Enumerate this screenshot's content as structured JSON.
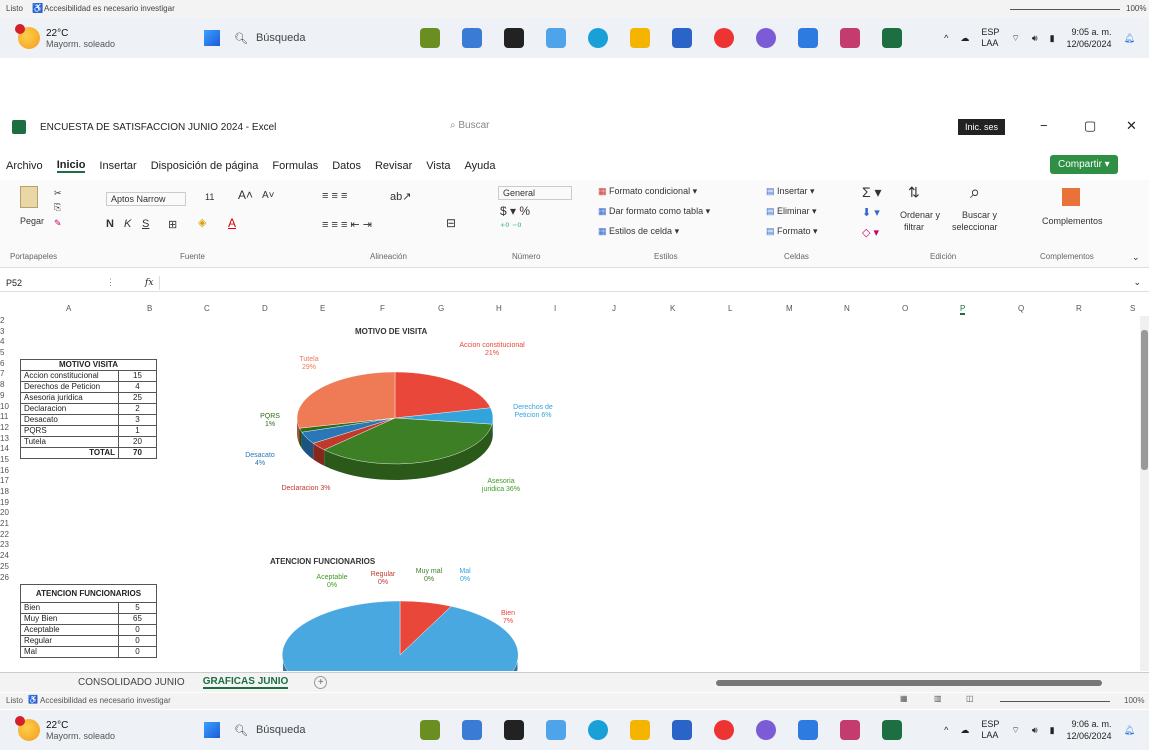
{
  "top_status": {
    "ready": "Listo",
    "accessibility": "Accesibilidad es necesario investigar",
    "zoom": "100%"
  },
  "taskbar_top": {
    "temp": "22°C",
    "weather": "Mayorm. soleado",
    "search": "Búsqueda",
    "lang1": "ESP",
    "lang2": "LAA",
    "time": "9:05 a. m.",
    "date": "12/06/2024"
  },
  "window": {
    "title": "ENCUESTA DE SATISFACCION JUNIO 2024 - Excel",
    "search_placeholder": "Buscar",
    "signin": "Inic. ses",
    "minimize": "−",
    "restore": "▢",
    "close": "✕"
  },
  "menu": {
    "items": [
      "Archivo",
      "Inicio",
      "Insertar",
      "Disposición de página",
      "Formulas",
      "Datos",
      "Revisar",
      "Vista",
      "Ayuda"
    ],
    "share": "Compartir"
  },
  "ribbon": {
    "paste": "Pegar",
    "font_name": "Aptos Narrow",
    "font_size": "11",
    "number_format": "General",
    "cond_format": "Formato condicional",
    "format_table": "Dar formato como tabla",
    "cell_styles": "Estilos de celda",
    "insert": "Insertar",
    "delete": "Eliminar",
    "format": "Formato",
    "sort_filter_1": "Ordenar y",
    "sort_filter_2": "filtrar",
    "find_1": "Buscar y",
    "find_2": "seleccionar",
    "addins": "Complementos",
    "groups": [
      "Portapapeles",
      "Fuente",
      "Alineación",
      "Número",
      "Estilos",
      "Celdas",
      "Edición",
      "Complementos"
    ]
  },
  "formula_bar": {
    "cell_ref": "P52",
    "fx": "fx"
  },
  "columns": [
    "A",
    "B",
    "C",
    "D",
    "E",
    "F",
    "G",
    "H",
    "I",
    "J",
    "K",
    "L",
    "M",
    "N",
    "O",
    "P",
    "Q",
    "R",
    "S"
  ],
  "rows": [
    "2",
    "3",
    "4",
    "5",
    "6",
    "7",
    "8",
    "9",
    "10",
    "11",
    "12",
    "13",
    "14",
    "15",
    "16",
    "17",
    "18",
    "19",
    "20",
    "21",
    "22",
    "23",
    "24",
    "25",
    "26"
  ],
  "table_motivo": {
    "header": "MOTIVO VISITA",
    "rows": [
      {
        "label": "Accion constitucional",
        "value": "15"
      },
      {
        "label": "Derechos de Peticion",
        "value": "4"
      },
      {
        "label": "Asesoria juridica",
        "value": "25"
      },
      {
        "label": "Declaracion",
        "value": "2"
      },
      {
        "label": "Desacato",
        "value": "3"
      },
      {
        "label": "PQRS",
        "value": "1"
      },
      {
        "label": "Tutela",
        "value": "20"
      }
    ],
    "total_label": "TOTAL",
    "total_value": "70"
  },
  "table_atencion": {
    "header": "ATENCION FUNCIONARIOS",
    "rows": [
      {
        "label": "Bien",
        "value": "5"
      },
      {
        "label": "Muy Bien",
        "value": "65"
      },
      {
        "label": "Aceptable",
        "value": "0"
      },
      {
        "label": "Regular",
        "value": "0"
      },
      {
        "label": "Mal",
        "value": "0"
      }
    ]
  },
  "chart_data": [
    {
      "type": "pie",
      "title": "MOTIVO DE VISITA",
      "categories": [
        "Accion constitucional",
        "Derechos de Peticion",
        "Asesoria juridica",
        "Declaracion",
        "Desacato",
        "PQRS",
        "Tutela"
      ],
      "values": [
        15,
        4,
        25,
        2,
        3,
        1,
        20
      ],
      "labels": [
        "Accion constitucional 21%",
        "Derechos de Peticion 6%",
        "Asesoria juridica 36%",
        "Declaracion 3%",
        "Desacato 4%",
        "PQRS 1%",
        "Tutela 29%"
      ],
      "colors": [
        "#e8473a",
        "#33a3dc",
        "#3d7f24",
        "#c0392b",
        "#2a77b8",
        "#2d6b1a",
        "#ef7a56"
      ]
    },
    {
      "type": "pie",
      "title": "ATENCION FUNCIONARIOS",
      "categories": [
        "Bien",
        "Muy Bien",
        "Aceptable",
        "Regular",
        "Muy mal",
        "Mal"
      ],
      "values": [
        5,
        65,
        0,
        0,
        0,
        0
      ],
      "labels": [
        "Bien 7%",
        "Aceptable 0%",
        "Regular 0%",
        "Muy mal 0%",
        "Mal 0%"
      ],
      "colors": [
        "#e8473a",
        "#4aa8e0"
      ]
    }
  ],
  "sheet_tabs": {
    "tab1": "CONSOLIDADO JUNIO",
    "tab2": "GRAFICAS JUNIO",
    "add": "+"
  },
  "status_bottom": {
    "ready": "Listo",
    "accessibility": "Accesibilidad es necesario investigar",
    "zoom": "100%"
  },
  "taskbar_bottom": {
    "temp": "22°C",
    "weather": "Mayorm. soleado",
    "search": "Búsqueda",
    "lang1": "ESP",
    "lang2": "LAA",
    "time": "9:06 a. m.",
    "date": "12/06/2024"
  }
}
